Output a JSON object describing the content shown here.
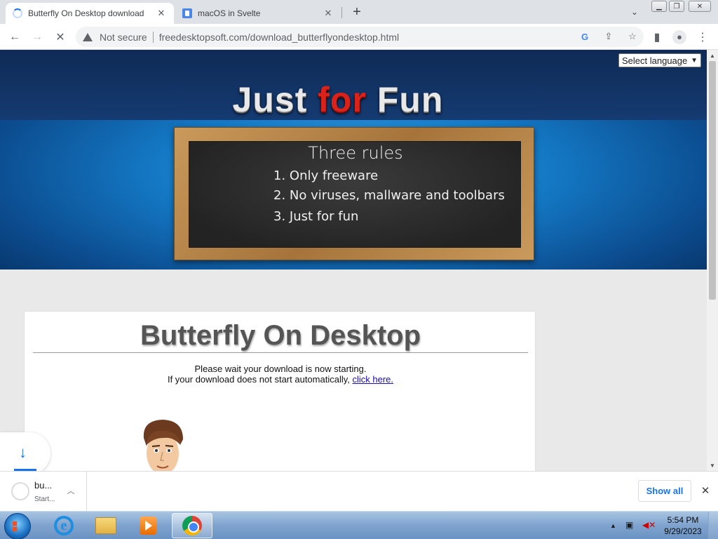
{
  "tabs": [
    {
      "title": "Butterfly On Desktop download",
      "state": "loading"
    },
    {
      "title": "macOS in Svelte",
      "state": "inactive"
    }
  ],
  "new_tab_symbol": "+",
  "toolbar": {
    "not_secure": "Not secure",
    "url": "freedesktopsoft.com/download_butterflyondesktop.html",
    "icons": [
      "back-icon",
      "forward-icon",
      "stop-icon",
      "google-lens-icon",
      "share-icon",
      "bookmark-star-icon",
      "side-panel-icon",
      "profile-icon",
      "menu-icon"
    ]
  },
  "page": {
    "language_select": "Select language",
    "headline": {
      "word1": "Just",
      "word2": "for",
      "word3": "Fun"
    },
    "board": {
      "title": "Three rules",
      "rules": [
        "1. Only freeware",
        "2. No viruses, mallware and toolbars",
        "3. Just for fun"
      ]
    },
    "card": {
      "title": "Butterfly On Desktop",
      "line1": "Please wait your download is now starting.",
      "line2": "If your download does not start automatically,",
      "link": "click here."
    }
  },
  "download_shelf": {
    "file_name": "bu...",
    "status": "Start...",
    "show_all": "Show all"
  },
  "taskbar": {
    "apps": [
      "internet-explorer-icon",
      "file-explorer-icon",
      "media-player-icon",
      "chrome-icon"
    ],
    "time": "5:54 PM",
    "date": "9/29/2023"
  },
  "colors": {
    "accent": "#1a73e8",
    "headline_red": "#d8221a",
    "hero_blue": "#1478c4",
    "link": "#1a0dab"
  }
}
